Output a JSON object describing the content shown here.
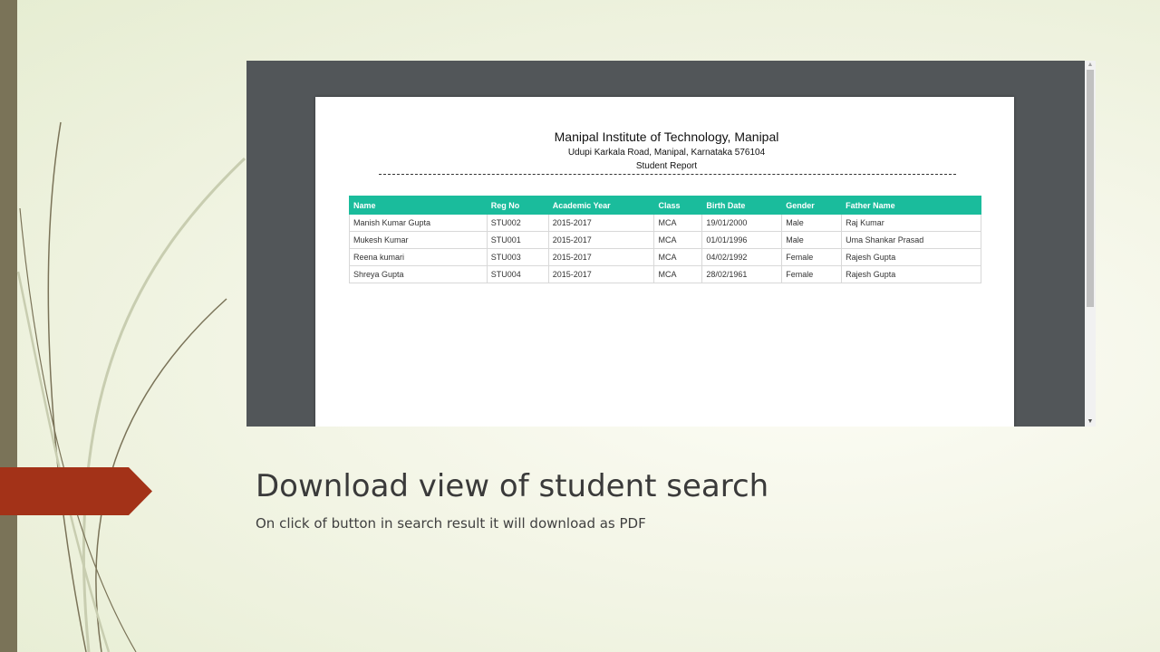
{
  "slide": {
    "title": "Download view of student search",
    "subtitle": "On click of button in search result it will download as PDF"
  },
  "colors": {
    "left_bar": "#7a7358",
    "arrow_tab": "#a33218",
    "viewer_bg": "#525659",
    "table_header": "#1abc9c"
  },
  "pdf": {
    "title": "Manipal Institute of Technology, Manipal",
    "address": "Udupi Karkala Road, Manipal, Karnataka 576104",
    "subtitle": "Student Report",
    "columns": [
      "Name",
      "Reg No",
      "Academic Year",
      "Class",
      "Birth Date",
      "Gender",
      "Father Name"
    ],
    "rows": [
      [
        "Manish Kumar Gupta",
        "STU002",
        "2015-2017",
        "MCA",
        "19/01/2000",
        "Male",
        "Raj Kumar"
      ],
      [
        "Mukesh Kumar",
        "STU001",
        "2015-2017",
        "MCA",
        "01/01/1996",
        "Male",
        "Uma Shankar Prasad"
      ],
      [
        "Reena kumari",
        "STU003",
        "2015-2017",
        "MCA",
        "04/02/1992",
        "Female",
        "Rajesh Gupta"
      ],
      [
        "Shreya Gupta",
        "STU004",
        "2015-2017",
        "MCA",
        "28/02/1961",
        "Female",
        "Rajesh Gupta"
      ]
    ]
  },
  "scrollbar": {
    "up_icon": "▲",
    "down_icon": "▼"
  }
}
